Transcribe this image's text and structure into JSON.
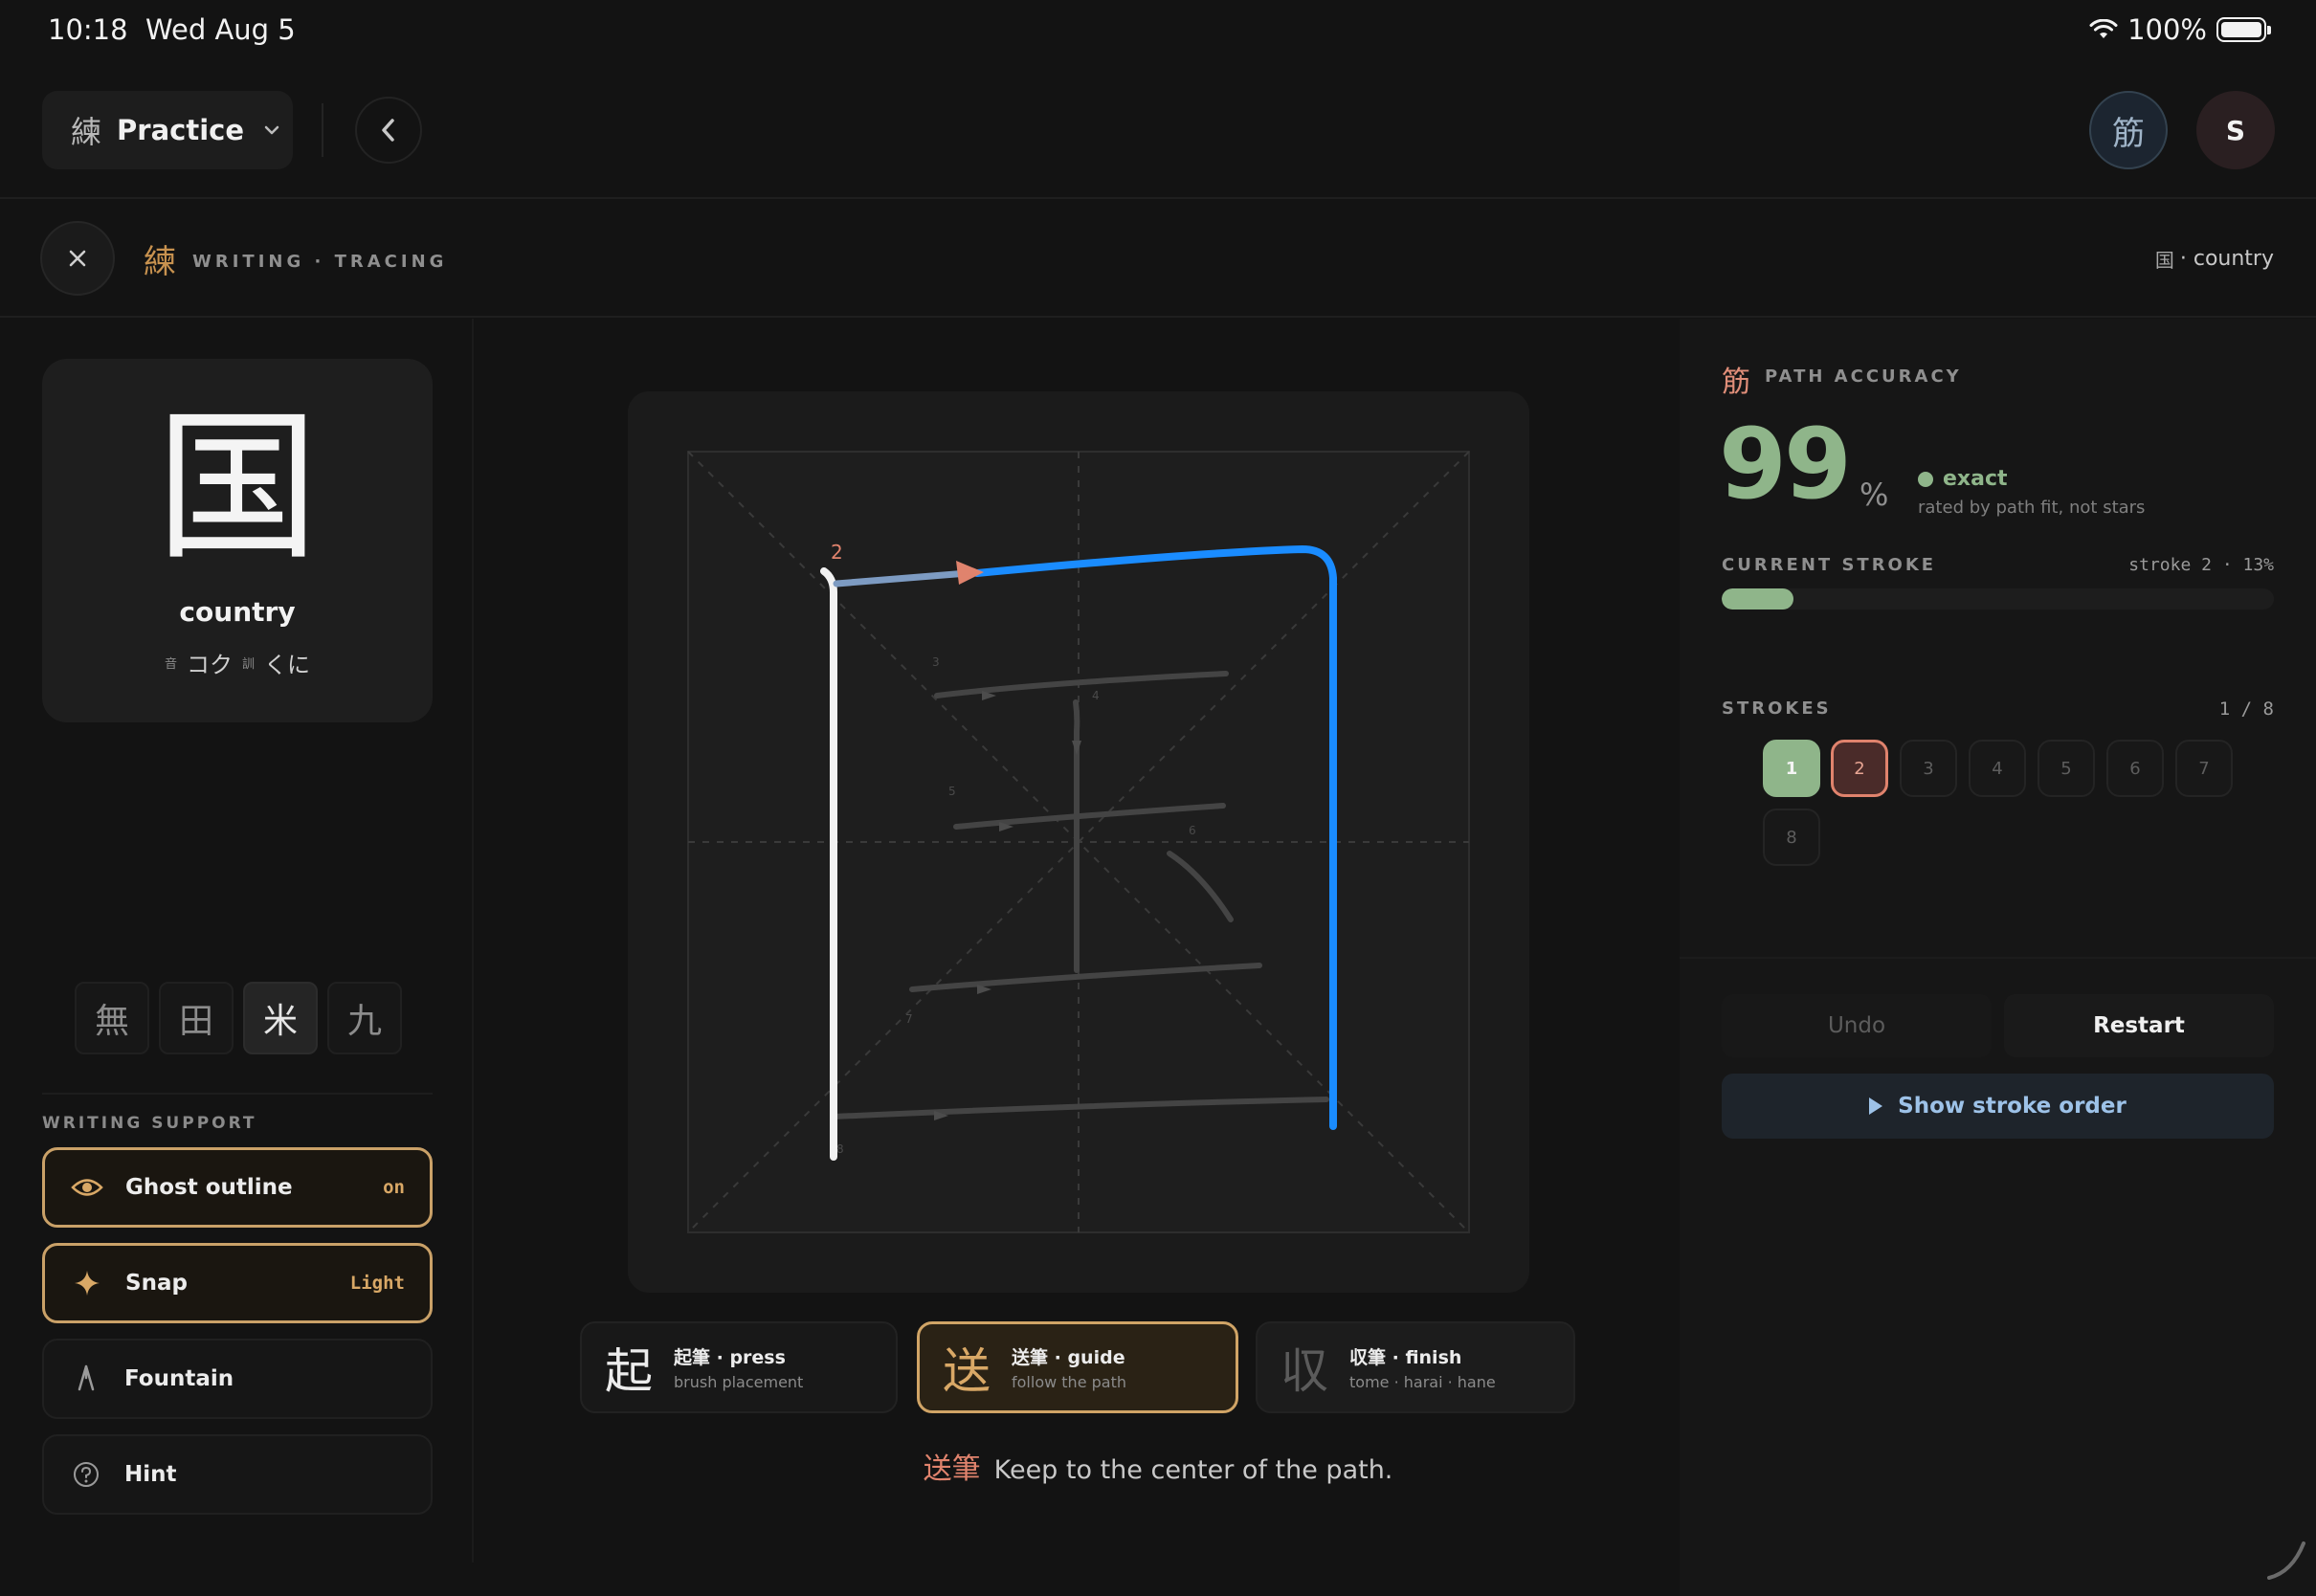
{
  "status_bar": {
    "time": "10:18",
    "date": "Wed Aug 5",
    "battery": "100%"
  },
  "nav": {
    "mode_glyph": "練",
    "mode_label": "Practice",
    "kanji_avatar": "筋",
    "user_initial": "S"
  },
  "subheader": {
    "glyph": "練",
    "label": "WRITING · TRACING",
    "crumb_kanji": "国",
    "crumb_text": "· country"
  },
  "character": {
    "kanji": "国",
    "meaning": "country",
    "on_tag": "音",
    "on_reading": "コク",
    "kun_tag": "訓",
    "kun_reading": "くに"
  },
  "grid_options": [
    {
      "glyph": "無",
      "active": false
    },
    {
      "glyph": "田",
      "active": false
    },
    {
      "glyph": "米",
      "active": true
    },
    {
      "glyph": "九",
      "active": false
    }
  ],
  "writing_support": {
    "title": "WRITING SUPPORT",
    "items": [
      {
        "label": "Ghost outline",
        "value": "on",
        "icon": "eye-icon",
        "active": true
      },
      {
        "label": "Snap",
        "value": "Light",
        "icon": "sparkle-icon",
        "active": true
      },
      {
        "label": "Fountain",
        "value": "",
        "icon": "fountain-pen-icon",
        "active": false
      },
      {
        "label": "Hint",
        "value": "",
        "icon": "question-circle-icon",
        "active": false
      }
    ]
  },
  "canvas": {
    "current_stroke_label": "2",
    "ghost_stroke_numbers": [
      "3",
      "4",
      "5",
      "6",
      "7",
      "8"
    ]
  },
  "phases": [
    {
      "kanji": "起",
      "title": "起筆 · press",
      "sub": "brush placement",
      "state": "normal"
    },
    {
      "kanji": "送",
      "title": "送筆 · guide",
      "sub": "follow the path",
      "state": "active"
    },
    {
      "kanji": "収",
      "title": "収筆 · finish",
      "sub": "tome · harai · hane",
      "state": "dim"
    }
  ],
  "hint": {
    "kanji": "送筆",
    "text": "Keep to the center of the path."
  },
  "accuracy": {
    "glyph": "筋",
    "title": "PATH ACCURACY",
    "value": "99",
    "unit": "%",
    "status": "exact",
    "subtitle": "rated by path fit, not stars",
    "current_stroke_title": "CURRENT STROKE",
    "current_stroke_info": "stroke 2 · 13%",
    "current_stroke_progress": 0.13
  },
  "strokes": {
    "title": "STROKES",
    "count": "1 / 8",
    "chips": [
      {
        "label": "1",
        "state": "done"
      },
      {
        "label": "2",
        "state": "current"
      },
      {
        "label": "3",
        "state": "pending"
      },
      {
        "label": "4",
        "state": "pending"
      },
      {
        "label": "5",
        "state": "pending"
      },
      {
        "label": "6",
        "state": "pending"
      },
      {
        "label": "7",
        "state": "pending"
      },
      {
        "label": "8",
        "state": "pending"
      }
    ]
  },
  "actions": {
    "undo": "Undo",
    "restart": "Restart",
    "show_order": "Show stroke order"
  },
  "colors": {
    "accent_gold": "#d9a866",
    "accent_green": "#8fb58a",
    "accent_coral": "#e0836d",
    "stroke_blue": "#1a8cff"
  }
}
